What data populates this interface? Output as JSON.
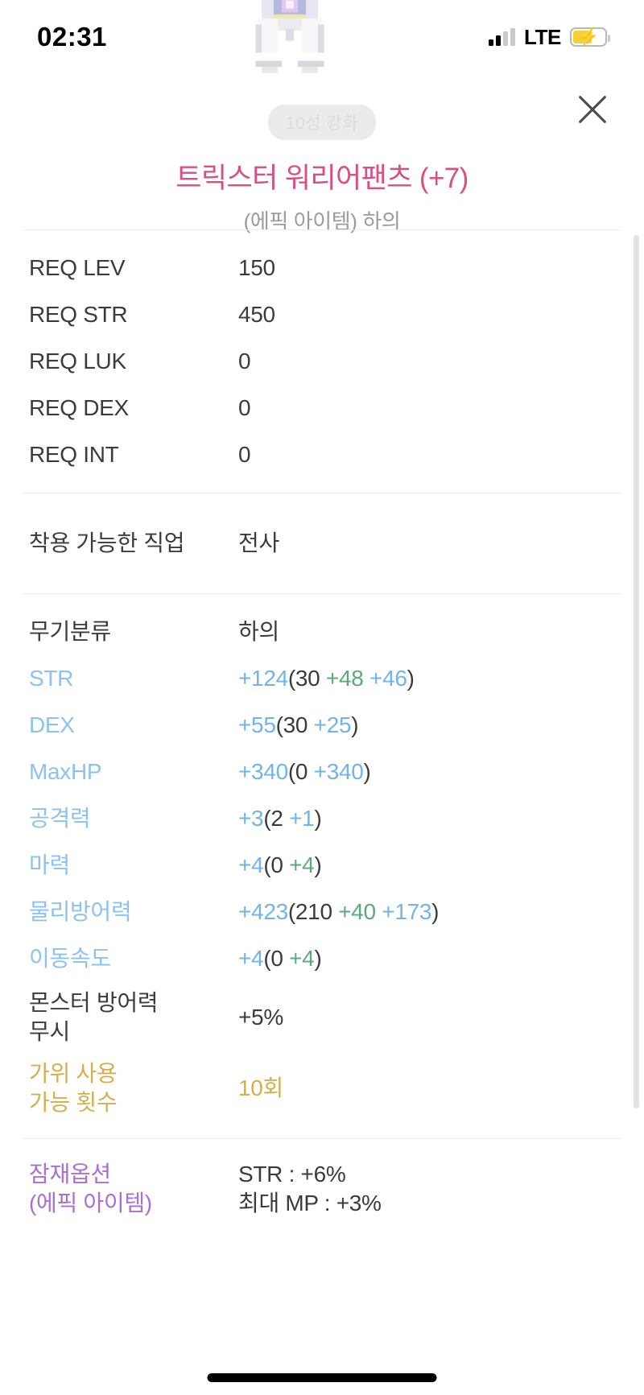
{
  "status_bar": {
    "time": "02:31",
    "network_label": "LTE",
    "signal_icon": "signal-bars-icon",
    "battery_icon": "battery-charging-icon"
  },
  "header": {
    "sprite_icon": "item-sprite-pants",
    "close_icon": "close-icon",
    "badge": "10성 강화",
    "title": "트릭스터 워리어팬츠 (+7)",
    "subtitle": "(에픽 아이템) 하의"
  },
  "requirements": [
    {
      "label": "REQ LEV",
      "value": "150"
    },
    {
      "label": "REQ STR",
      "value": "450"
    },
    {
      "label": "REQ LUK",
      "value": "0"
    },
    {
      "label": "REQ DEX",
      "value": "0"
    },
    {
      "label": "REQ INT",
      "value": "0"
    }
  ],
  "job": {
    "label": "착용 가능한 직업",
    "value": "전사"
  },
  "stats": {
    "category": {
      "label": "무기분류",
      "value": "하의"
    },
    "rows": [
      {
        "label": "STR",
        "total": "+124",
        "open": "(",
        "base": "30",
        "mid": " +48",
        "extra": " +46",
        "close": ")"
      },
      {
        "label": "DEX",
        "total": "+55",
        "open": "(",
        "base": "30",
        "mid": "",
        "extra": " +25",
        "close": ")"
      },
      {
        "label": "MaxHP",
        "total": "+340",
        "open": "(",
        "base": "0",
        "mid": "",
        "extra": " +340",
        "close": ")"
      },
      {
        "label": "공격력",
        "total": "+3",
        "open": "(",
        "base": "2",
        "mid": "",
        "extra": " +1",
        "close": ")"
      },
      {
        "label": "마력",
        "total": "+4",
        "open": "(",
        "base": "0",
        "mid": " +4",
        "extra": "",
        "close": ")"
      },
      {
        "label": "물리방어력",
        "total": "+423",
        "open": "(",
        "base": "210",
        "mid": " +40",
        "extra": " +173",
        "close": ")"
      },
      {
        "label": "이동속도",
        "total": "+4",
        "open": "(",
        "base": "0",
        "mid": " +4",
        "extra": "",
        "close": ")"
      }
    ],
    "monster_def_ignore": {
      "label": "몬스터 방어력\n무시",
      "value": "+5%"
    },
    "scissors": {
      "label": "가위 사용\n가능 횟수",
      "value": "10회"
    }
  },
  "potential": {
    "label": "잠재옵션\n(에픽 아이템)",
    "lines": "STR : +6%\n최대 MP : +3%"
  },
  "colors": {
    "title_pink": "#d94f84",
    "stat_blue": "#8cc2ef",
    "value_blue": "#72b4e8",
    "value_green": "#5ea97a",
    "gold": "#d4af4a",
    "purple": "#a96fd6",
    "battery_yellow": "#f5cf35"
  }
}
